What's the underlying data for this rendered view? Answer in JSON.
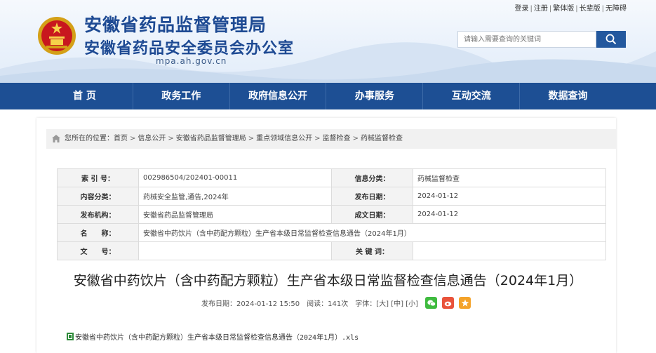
{
  "header": {
    "title_main": "安徽省药品监督管理局",
    "title_sub": "安徽省药品安全委员会办公室",
    "domain": "mpa.ah.gov.cn",
    "top_links": [
      "登录",
      "注册",
      "繁体版",
      "长辈版",
      "无障碍"
    ],
    "search_placeholder": "请输入需要查询的关键词"
  },
  "nav": {
    "items": [
      "首 页",
      "政务工作",
      "政府信息公开",
      "办事服务",
      "互动交流",
      "数据查询"
    ]
  },
  "breadcrumb": {
    "prefix": "您所在的位置：",
    "items": [
      "首页",
      "信息公开",
      "安徽省药品监督管理局",
      "重点领域信息公开",
      "监督检查",
      "药械监督检查"
    ],
    "separator": ">"
  },
  "meta": {
    "index_label": "索 引 号：",
    "index_value": "002986504/202401-00011",
    "category_label": "信息分类：",
    "category_value": "药械监督检查",
    "content_type_label": "内容分类：",
    "content_type_value": "药械安全监管,通告,2024年",
    "publish_date_label": "发布日期：",
    "publish_date_value": "2024-01-12",
    "org_label": "发布机构：",
    "org_value": "安徽省药品监督管理局",
    "created_date_label": "成文日期：",
    "created_date_value": "2024-01-12",
    "name_label": "名　　称：",
    "name_value": "安徽省中药饮片（含中药配方颗粒）生产省本级日常监督检查信息通告（2024年1月）",
    "doc_no_label": "文　　号：",
    "doc_no_value": "",
    "keywords_label": "关 键 词：",
    "keywords_value": ""
  },
  "article": {
    "title": "安徽省中药饮片（含中药配方颗粒）生产省本级日常监督检查信息通告（2024年1月）",
    "publish_time": "发布日期：2024-01-12 15:50",
    "views": "阅读：141次",
    "font_label": "字体：",
    "font_large": "[大]",
    "font_medium": "[中]",
    "font_small": "[小]",
    "attachment": "安徽省中药饮片（含中药配方颗粒）生产省本级日常监督检查信息通告（2024年1月）.xls"
  },
  "colors": {
    "brand_blue": "#1d4f94",
    "title_blue": "#1e4a93",
    "wechat_green": "#3fbb3f",
    "weibo_red": "#e9533b",
    "favorite_orange": "#f4a32a"
  }
}
